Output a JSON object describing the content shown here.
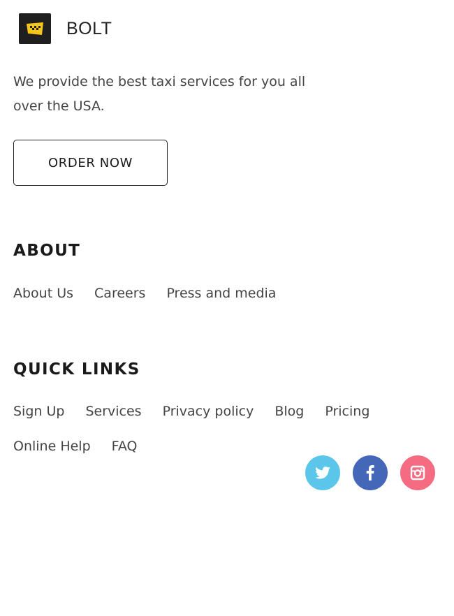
{
  "brand": {
    "name": "BOLT",
    "logo_icon": "taxi-checker-icon",
    "logo_color": "#f5c518",
    "logo_bg": "#1f1f1f"
  },
  "hero": {
    "tagline": "We provide the best taxi services for you all over the USA.",
    "order_button": "ORDER NOW"
  },
  "about": {
    "title": "ABOUT",
    "links": [
      "About Us",
      "Careers",
      "Press and media"
    ]
  },
  "quick_links": {
    "title": "QUICK LINKS",
    "links": [
      "Sign Up",
      "Services",
      "Privacy policy",
      "Blog",
      "Pricing",
      "Online Help",
      "FAQ"
    ]
  },
  "social": [
    {
      "icon": "twitter-icon",
      "color": "#5bc6ea"
    },
    {
      "icon": "facebook-icon",
      "color": "#4567b8"
    },
    {
      "icon": "instagram-icon",
      "color": "#f46b82"
    }
  ]
}
